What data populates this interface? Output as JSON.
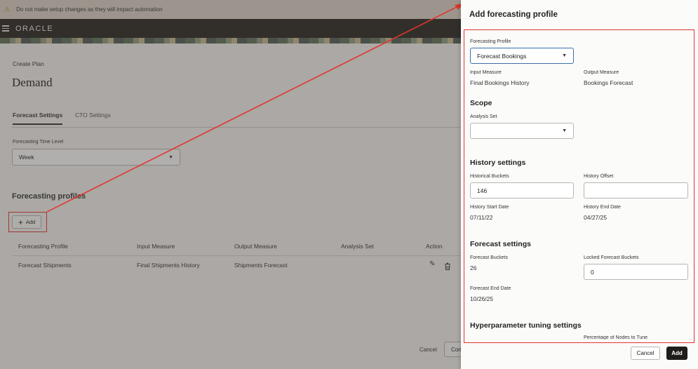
{
  "banner": {
    "icon": "warning-icon",
    "text": "Do not make setup changes as they will impact automation"
  },
  "header": {
    "logo": "ORACLE"
  },
  "page": {
    "breadcrumb": "Create Plan",
    "title": "Demand",
    "tabs": [
      {
        "label": "Forecast Settings",
        "active": true
      },
      {
        "label": "CTO Settings",
        "active": false
      }
    ],
    "time_level": {
      "label": "Forecasting Time Level",
      "value": "Week"
    },
    "profiles": {
      "heading": "Forecasting profiles",
      "add_label": "Add",
      "columns": [
        "Forecasting Profile",
        "Input Measure",
        "Output Measure",
        "Analysis Set",
        "Action"
      ],
      "rows": [
        {
          "profile": "Forecast Shipments",
          "input": "Final Shipments History",
          "output": "Shipments Forecast",
          "analysis_set": ""
        }
      ]
    },
    "footer": {
      "cancel": "Cancel",
      "continue_partial": "Con"
    }
  },
  "panel": {
    "title": "Add forecasting profile",
    "profile": {
      "label": "Forecasting Profile",
      "value": "Forecast Bookings"
    },
    "input_measure": {
      "label": "Input Measure",
      "value": "Final Bookings History"
    },
    "output_measure": {
      "label": "Output Measure",
      "value": "Bookings Forecast"
    },
    "scope": {
      "heading": "Scope",
      "analysis_set_label": "Analysis Set",
      "analysis_set_value": ""
    },
    "history": {
      "heading": "History settings",
      "buckets_label": "Historical Buckets",
      "buckets_value": "146",
      "offset_label": "History Offset",
      "offset_value": "",
      "start_label": "History Start Date",
      "start_value": "07/11/22",
      "end_label": "History End Date",
      "end_value": "04/27/25"
    },
    "forecast": {
      "heading": "Forecast settings",
      "buckets_label": "Forecast Buckets",
      "buckets_value": "26",
      "locked_label": "Locked Forecast Buckets",
      "locked_value": "0",
      "end_label": "Forecast End Date",
      "end_value": "10/26/25"
    },
    "hyper": {
      "heading": "Hyperparameter tuning settings",
      "partial_label": "Percentage of Nodes to Tune"
    },
    "buttons": {
      "cancel": "Cancel",
      "add": "Add"
    }
  },
  "colors": {
    "annotation": "#e0352b",
    "header_bg": "#252320",
    "banner_bg": "#dcd3c8",
    "primary_button": "#1f1d1b"
  }
}
